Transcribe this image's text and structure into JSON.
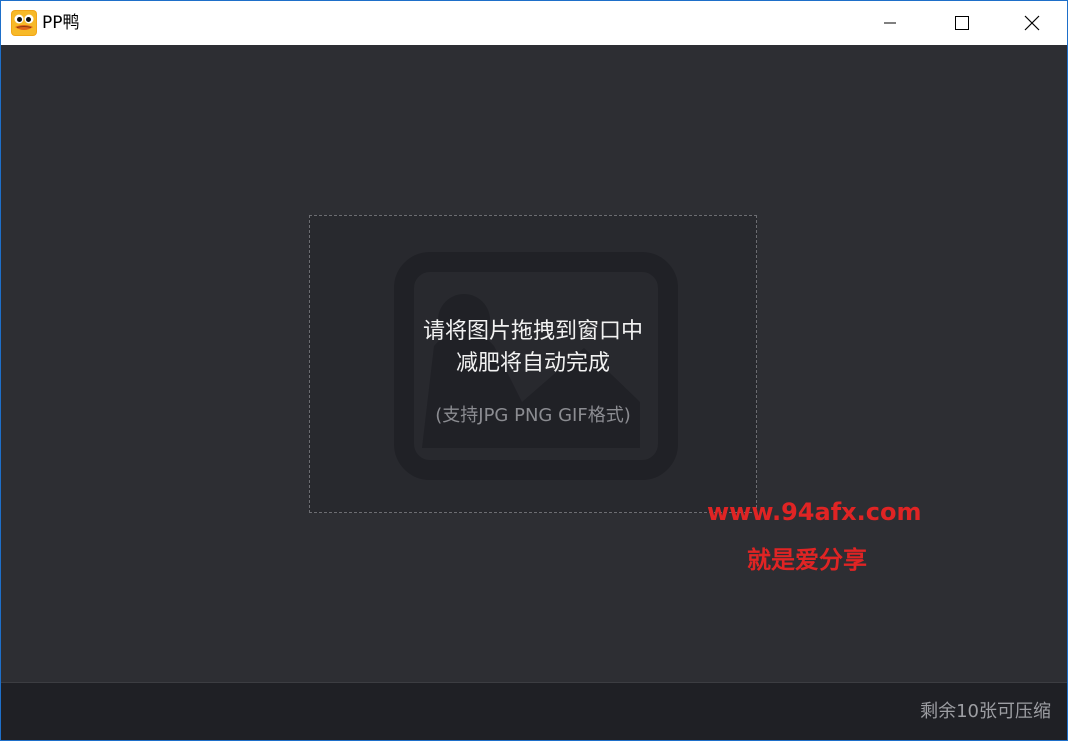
{
  "window": {
    "title": "PP鸭",
    "app_icon": "duck-app-icon",
    "controls": {
      "minimize": "minimize-icon",
      "maximize": "maximize-icon",
      "close": "close-icon"
    }
  },
  "dropzone": {
    "line1": "请将图片拖拽到窗口中",
    "line2": "减肥将自动完成",
    "hint": "(支持JPG PNG GIF格式)",
    "background_icon": "image-placeholder-icon"
  },
  "watermark": {
    "url": "www.94afx.com",
    "slogan": "就是爱分享",
    "color": "#e02424"
  },
  "footer": {
    "status": "剩余10张可压缩"
  },
  "colors": {
    "background": "#2d2e33",
    "dropzone_bg": "#28292e",
    "footer_bg": "#1f2025",
    "accent_border": "#1e6fc9"
  }
}
